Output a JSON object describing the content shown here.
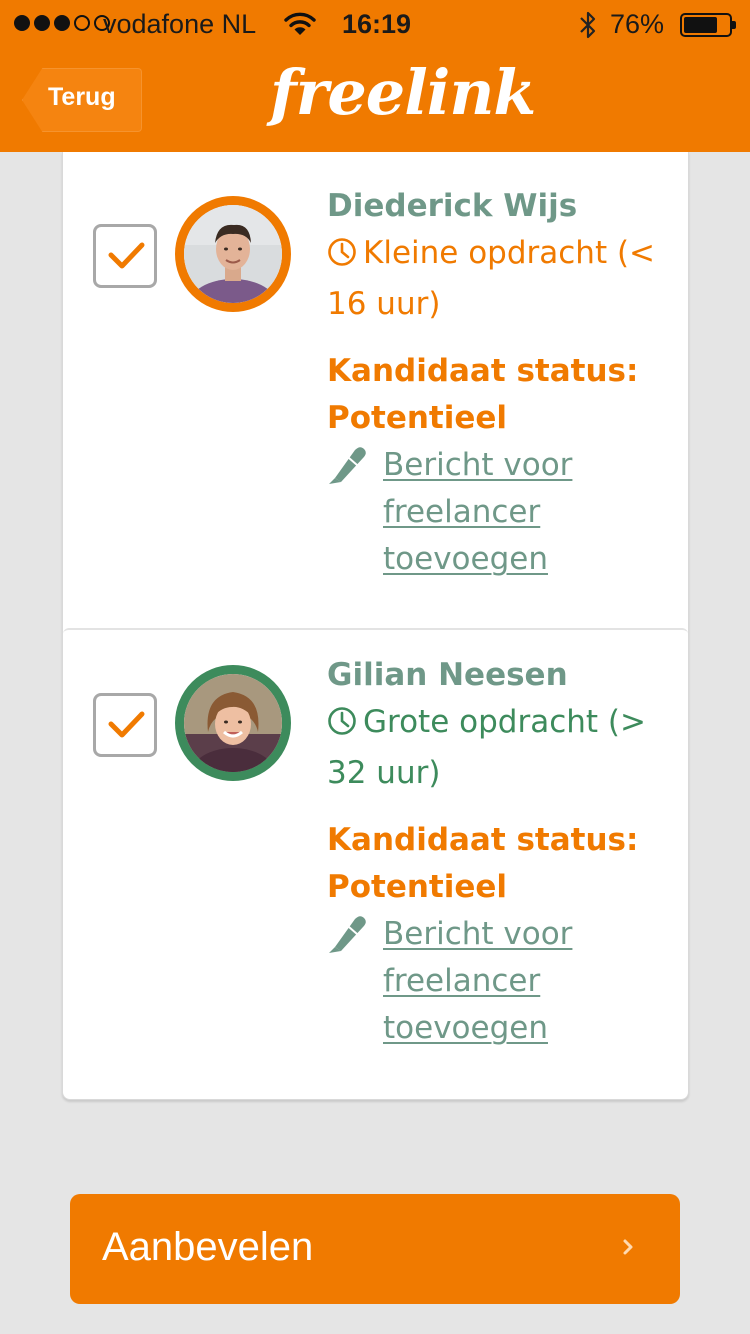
{
  "status_bar": {
    "carrier": "vodafone NL",
    "time": "16:19",
    "battery_percent_text": "76%",
    "battery_level": 0.76
  },
  "header": {
    "back_label": "Terug",
    "logo_text": "freelink"
  },
  "candidates": [
    {
      "name": "Diederick Wijs",
      "assignment_size": "Kleine opdracht (< 16 uur)",
      "size_color": "#f07a00",
      "ring_color": "#f07a00",
      "checked": true,
      "status_text": "Kandidaat status: Potentieel",
      "message_link": "Bericht voor freelancer toevoegen"
    },
    {
      "name": "Gilian Neesen",
      "assignment_size": "Grote opdracht (> 32 uur)",
      "size_color": "#3d8b5c",
      "ring_color": "#3d8b5c",
      "checked": true,
      "status_text": "Kandidaat status: Potentieel",
      "message_link": "Bericht voor freelancer toevoegen"
    }
  ],
  "footer": {
    "recommend_label": "Aanbevelen"
  },
  "colors": {
    "brand_orange": "#f07a00",
    "teal_text": "#6f9888",
    "green": "#3d8b5c",
    "background": "#e5e5e5"
  },
  "icons": [
    "wifi-icon",
    "bluetooth-icon",
    "battery-icon",
    "checkmark-icon",
    "clock-icon",
    "pen-icon",
    "chevron-right-icon"
  ]
}
